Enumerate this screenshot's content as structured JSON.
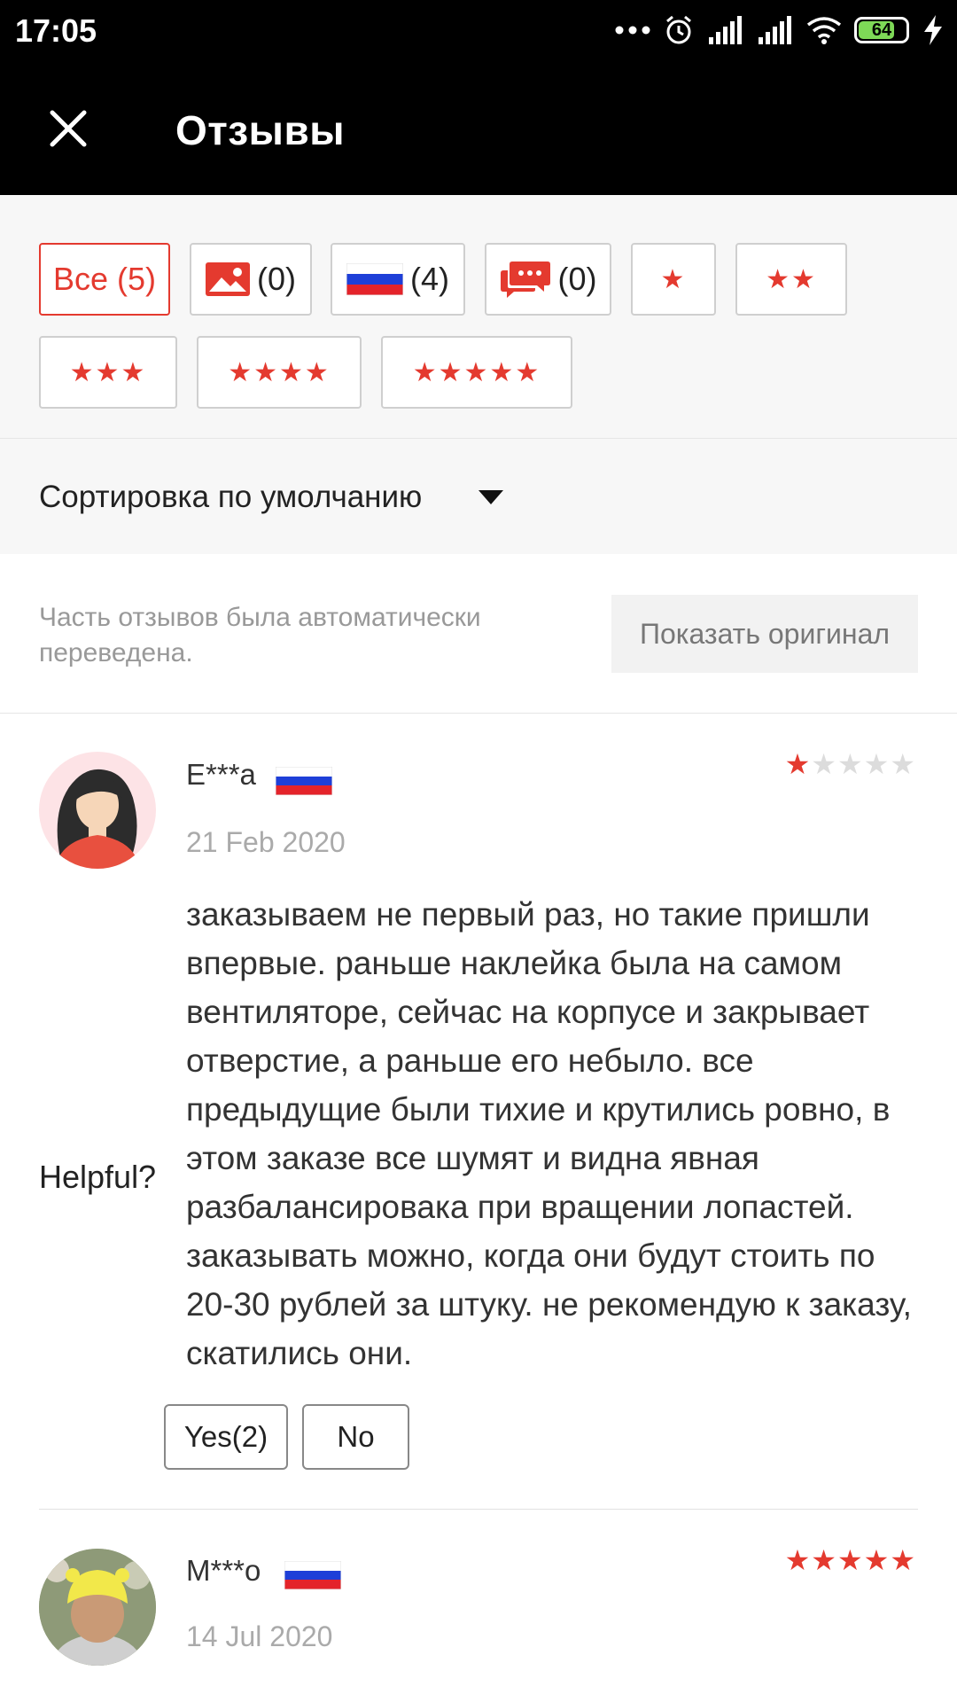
{
  "status_bar": {
    "time": "17:05",
    "battery": "64",
    "icons": [
      "more-dots-icon",
      "alarm-icon",
      "signal-icon",
      "signal-icon",
      "wifi-icon",
      "battery-icon",
      "charging-icon"
    ]
  },
  "toolbar": {
    "title": "Отзывы",
    "close_icon": "close-icon"
  },
  "filters": {
    "all_label": "Все (5)",
    "photo_count": "(0)",
    "country_count": "(4)",
    "comment_count": "(0)",
    "star_chips": [
      {
        "stars": "★"
      },
      {
        "stars": "★★"
      },
      {
        "stars": "★★★"
      },
      {
        "stars": "★★★★"
      },
      {
        "stars": "★★★★★"
      }
    ]
  },
  "sort": {
    "label": "Сортировка по умолчанию"
  },
  "notice": {
    "text": "Часть отзывов была автоматически переведена.",
    "button": "Показать оригинал"
  },
  "reviews": [
    {
      "name": "E***a",
      "country": "RU",
      "date": "21 Feb 2020",
      "rating": 1,
      "stars_on": "★",
      "stars_off": "★★★★",
      "text": "заказываем не первый раз, но такие пришли впервые. раньше наклейка была на самом вентиляторе, сейчас на корпусе и закрывает отверстие, а раньше его небыло. все предыдущие были тихие и крутились ровно, в этом заказе все шумят и видна явная разбалансировака при вращении лопастей. заказывать можно, когда они будут стоить по 20-30 рублей за штуку. не рекомендую к заказу, скатились они.",
      "helpful_label": "Helpful?",
      "yes_label": "Yes(2)",
      "no_label": "No"
    },
    {
      "name": "M***o",
      "country": "RU",
      "date": "14 Jul 2020",
      "rating": 5,
      "stars_on": "★★★★★",
      "stars_off": ""
    }
  ],
  "colors": {
    "accent": "#e43a2f",
    "header": "#000000",
    "filter_bg": "#f7f7f7"
  }
}
